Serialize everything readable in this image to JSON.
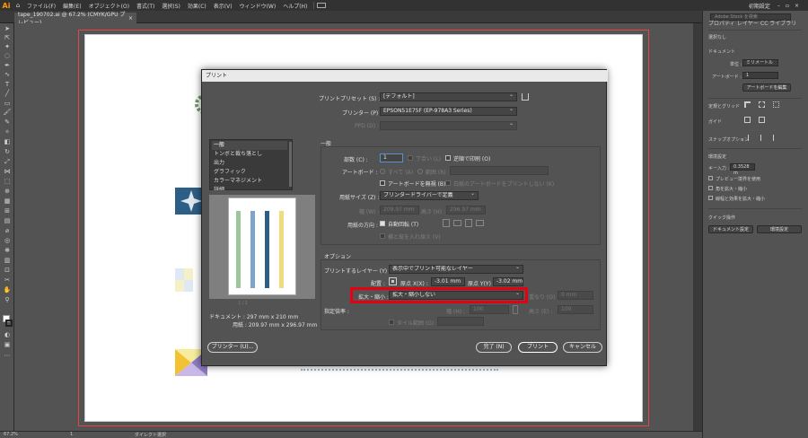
{
  "menubar": {
    "logo": "Ai",
    "items": [
      "ファイル(F)",
      "編集(E)",
      "オブジェクト(O)",
      "書式(T)",
      "選択(S)",
      "効果(C)",
      "表示(V)",
      "ウィンドウ(W)",
      "ヘルプ(H)"
    ],
    "workspace": "初期設定",
    "search_placeholder": "Adobe Stock を検索"
  },
  "document_tab": {
    "title": "tape_190702.ai @ 67.2% (CMYK/GPU プレビュー)",
    "close": "×"
  },
  "status_bar": {
    "zoom": "67.2%",
    "artboard": "1",
    "tool": "ダイレクト選択"
  },
  "dialog": {
    "title": "プリント",
    "preset_label": "プリントプリセット (S) :",
    "preset_value": "[デフォルト]",
    "printer_label": "プリンター (P) :",
    "printer_value": "EPSON51E75F (EP-978A3 Series)",
    "ppd_label": "PPD (D) :",
    "categories": [
      "一般",
      "トンボと裁ち落とし",
      "出力",
      "グラフィック",
      "カラーマネジメント",
      "詳細"
    ],
    "selected_category": "一般",
    "general": {
      "section_title": "一般",
      "copies_label": "部数 (C) :",
      "copies_value": "1",
      "collate_label": "丁合い (L)",
      "reverse_label": "逆順で印刷 (O)",
      "artboard_label": "アートボード :",
      "all_label": "すべて (A)",
      "range_label": "範囲 (R) :",
      "ignore_artboards_label": "アートボードを無視 (B)",
      "skip_blank_label": "白紙のアートボードをプリントしない (K)",
      "media_size_label": "用紙サイズ (Z) :",
      "media_size_value": "プリンタードライバーで定義",
      "width_label": "幅 (W) :",
      "width_value": "209.97 mm",
      "height_label": "高さ (H) :",
      "height_value": "296.97 mm",
      "orientation_label": "用紙の方向 :",
      "auto_rotate_label": "自動回転 (T)",
      "transverse_label": "横と縦を入れ換え (V)"
    },
    "options": {
      "section_title": "オプション",
      "print_layers_label": "プリントするレイヤー (Y) :",
      "print_layers_value": "表示中でプリント可能なレイヤー",
      "placement_label": "配置 :",
      "origin_x_label": "原点 X(X) :",
      "origin_x_value": "-3.01 mm",
      "origin_y_label": "原点 Y(Y) :",
      "origin_y_value": "-3.02 mm",
      "scaling_label": "拡大・縮小 :",
      "scaling_value": "拡大・縮小しない",
      "overlap_label": "重なり (O) :",
      "overlap_value": "0 mm",
      "custom_scale_label": "指定倍率 :",
      "scale_w_label": "幅 (H) :",
      "scale_w_value": "100",
      "scale_h_label": "高さ (E) :",
      "scale_h_value": "100",
      "tile_label": "タイル範囲 (G) :"
    },
    "document_info": "ドキュメント : 297 mm x 210 mm",
    "media_info": "用紙 : 209.97 mm x 296.97 mm",
    "pager_info": "1 / 1",
    "buttons": {
      "setup": "プリンター (U)...",
      "done": "完了 (N)",
      "print": "プリント",
      "cancel": "キャンセル"
    }
  },
  "right_panel": {
    "tabs": [
      "プロパティ",
      "レイヤー",
      "CC ライブラリ"
    ],
    "no_selection": "選択なし",
    "document_heading": "ドキュメント",
    "units_label": "単位 :",
    "units_value": "ミリメートル",
    "artboard_label": "アートボード :",
    "artboard_value": "1",
    "edit_artboards_button": "アートボードを編集",
    "rulers_grids_label": "定規とグリッド",
    "guides_label": "ガイド",
    "snap_options_label": "スナップオプション",
    "preferences_heading": "環境設定",
    "keyboard_increment_label": "キー入力 :",
    "keyboard_increment_value": "0.3528 m",
    "preview_bounds_label": "プレビュー境界を使用",
    "scale_corners_label": "角を拡大・縮小",
    "scale_strokes_label": "線幅と効果を拡大・縮小",
    "quick_actions_heading": "クイック操作",
    "document_setup_button": "ドキュメント設定",
    "preferences_button": "環境設定"
  },
  "colors": {
    "highlight": "#e60012",
    "accent": "#ff9a00"
  }
}
